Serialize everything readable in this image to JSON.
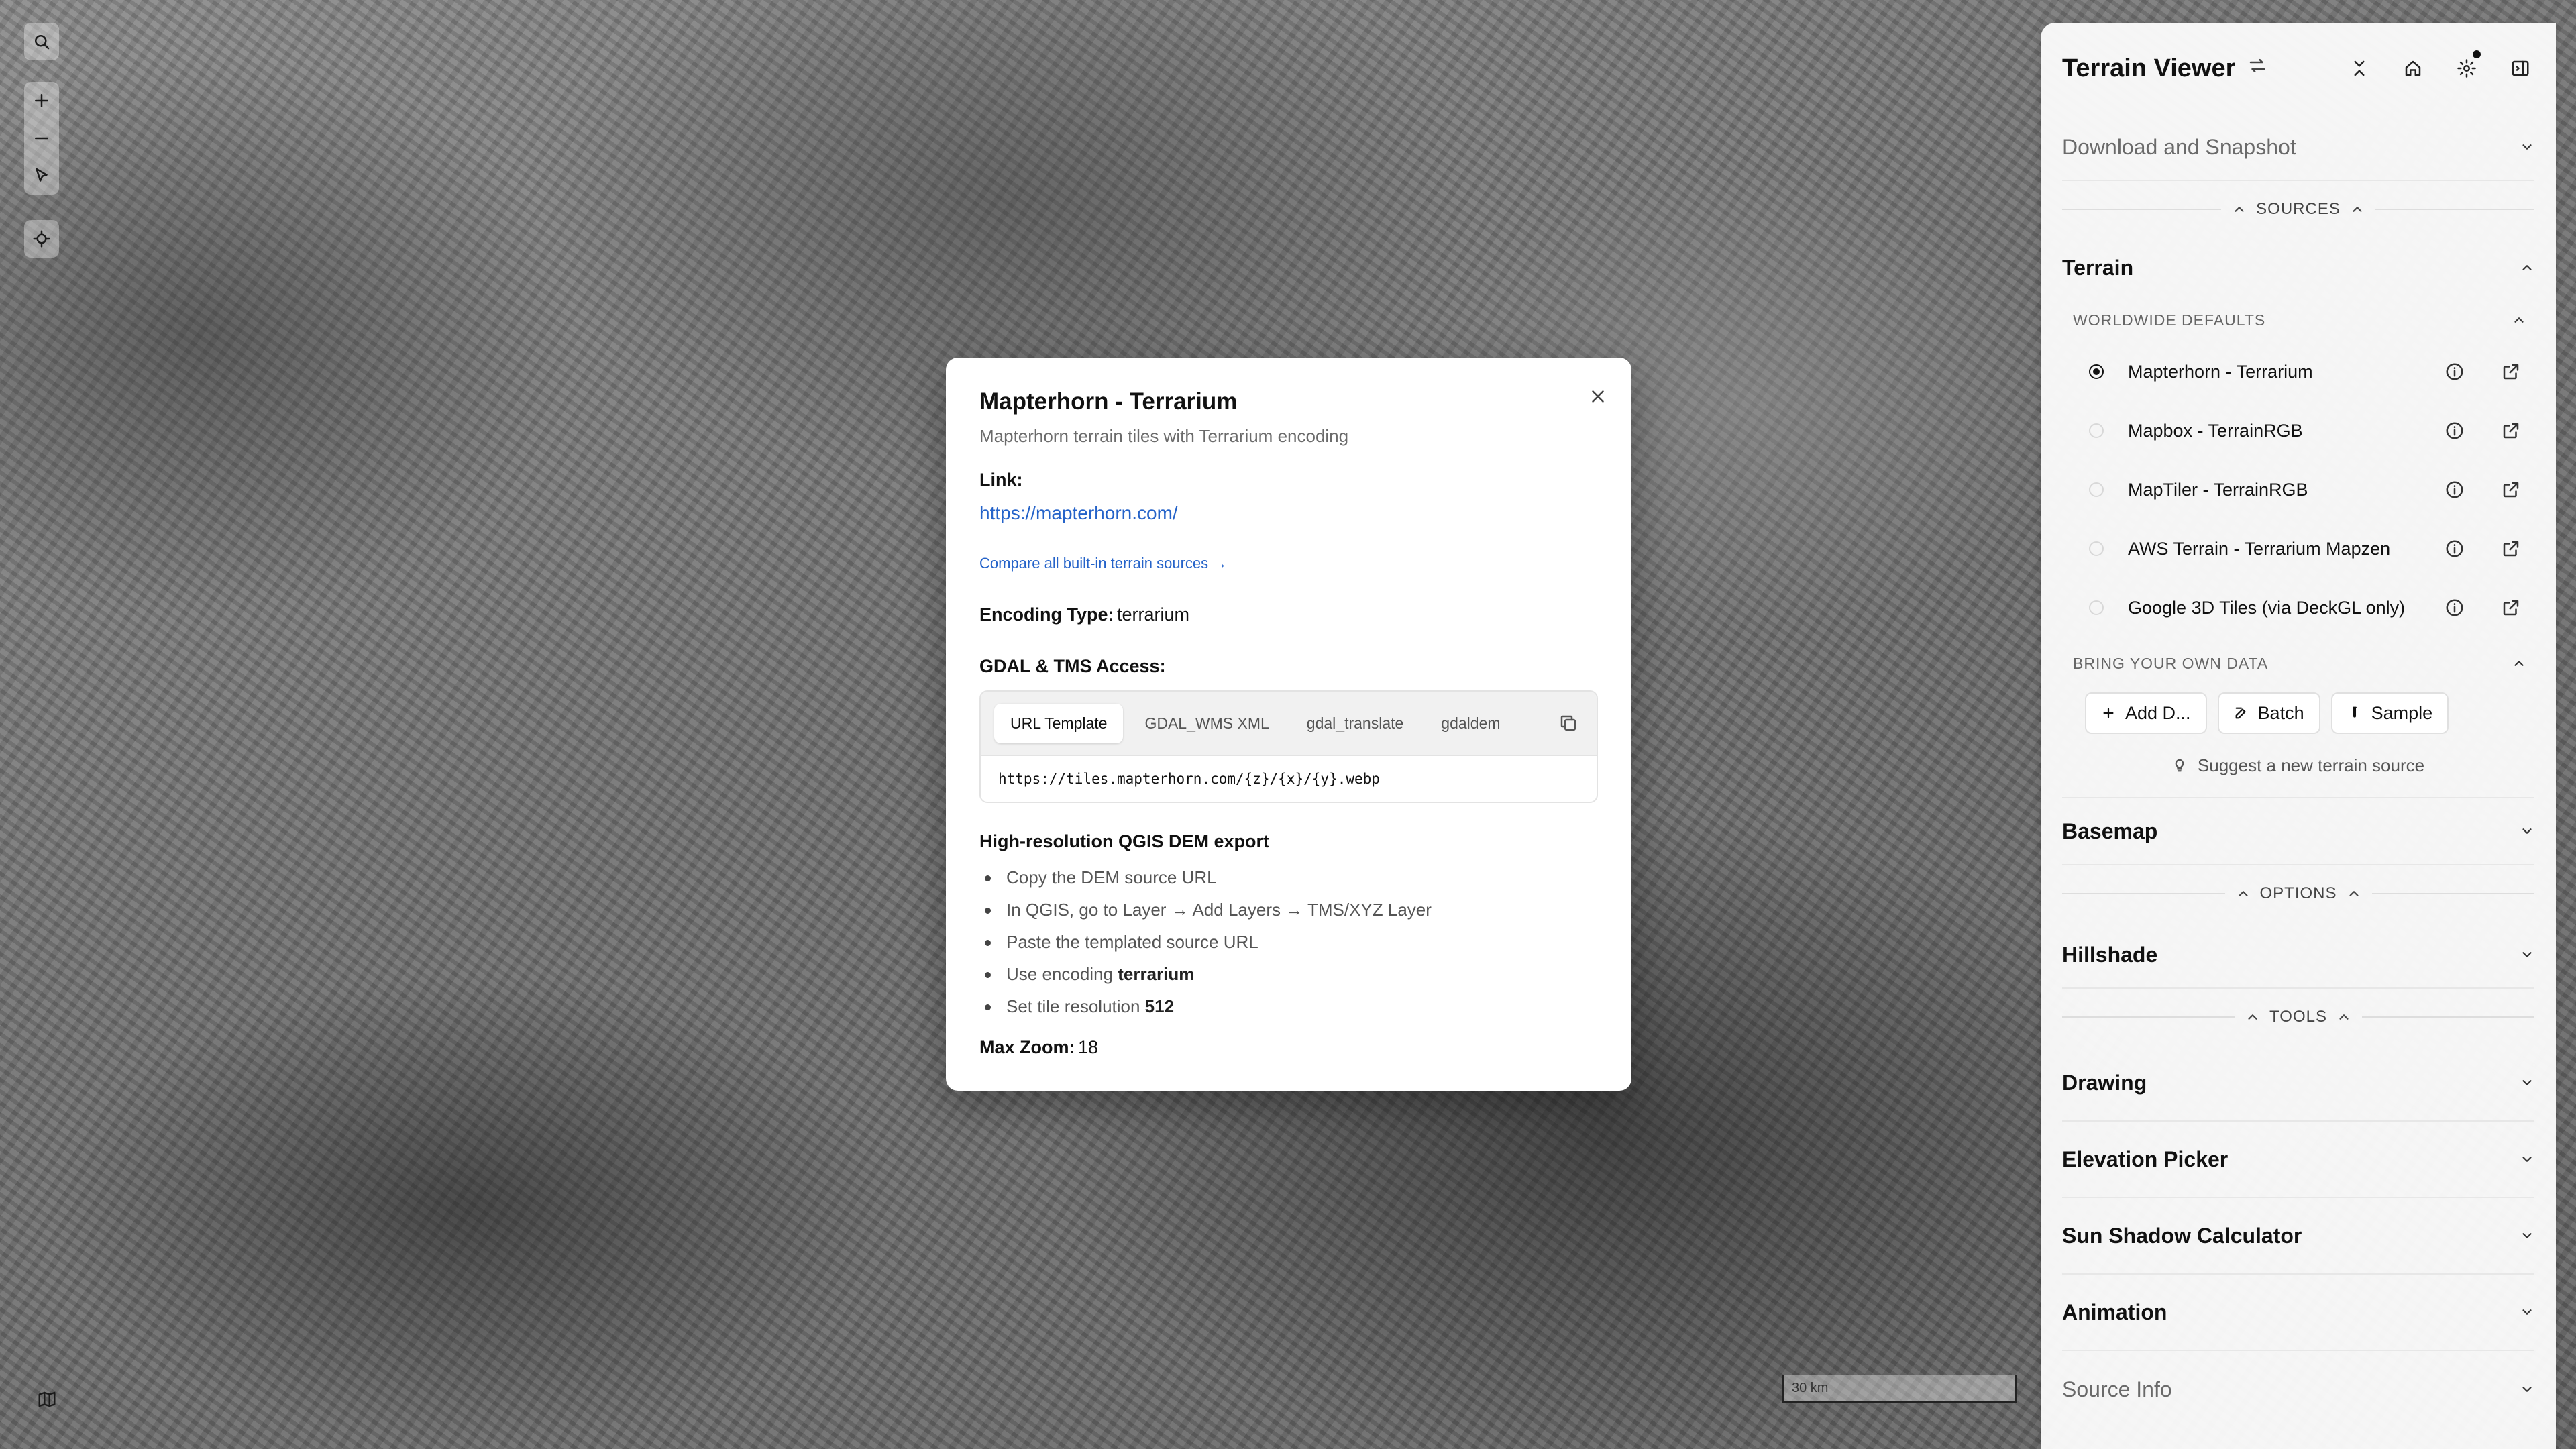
{
  "app": {
    "title": "Terrain Viewer"
  },
  "map": {
    "scale_label": "30 km"
  },
  "modal": {
    "title": "Mapterhorn - Terrarium",
    "subtitle": "Mapterhorn terrain tiles with Terrarium encoding",
    "link_label": "Link:",
    "link_url": "https://mapterhorn.com/",
    "compare_link": "Compare all built-in terrain sources →",
    "encoding_label": "Encoding Type:",
    "encoding_value": "terrarium",
    "gdal_label": "GDAL & TMS Access:",
    "tabs": [
      "URL Template",
      "GDAL_WMS XML",
      "gdal_translate",
      "gdaldem"
    ],
    "code": "https://tiles.mapterhorn.com/{z}/{x}/{y}.webp",
    "qgis_title": "High-resolution QGIS DEM export",
    "steps": {
      "s1": "Copy the DEM source URL",
      "s2": "In QGIS, go to Layer → Add Layers → TMS/XYZ Layer",
      "s3": "Paste the templated source URL",
      "s4_prefix": "Use encoding ",
      "s4_bold": "terrarium",
      "s5_prefix": "Set tile resolution ",
      "s5_bold": "512"
    },
    "maxzoom_label": "Max Zoom:",
    "maxzoom_value": "18"
  },
  "panel": {
    "download_section": "Download and Snapshot",
    "sources_label": "SOURCES",
    "terrain_section": "Terrain",
    "worldwide_label": "WORLDWIDE DEFAULTS",
    "sources": [
      {
        "name": "Mapterhorn - Terrarium",
        "selected": true
      },
      {
        "name": "Mapbox - TerrainRGB",
        "selected": false
      },
      {
        "name": "MapTiler - TerrainRGB",
        "selected": false
      },
      {
        "name": "AWS Terrain - Terrarium Mapzen",
        "selected": false
      },
      {
        "name": "Google 3D Tiles (via DeckGL only)",
        "selected": false
      }
    ],
    "own_data_label": "BRING YOUR OWN DATA",
    "own_buttons": {
      "add": "Add D...",
      "batch": "Batch",
      "sample": "Sample"
    },
    "suggest": "Suggest a new terrain source",
    "basemap_section": "Basemap",
    "options_label": "OPTIONS",
    "hillshade_section": "Hillshade",
    "tools_label": "TOOLS",
    "drawing_section": "Drawing",
    "elevation_section": "Elevation Picker",
    "sunshadow_section": "Sun Shadow Calculator",
    "animation_section": "Animation",
    "sourceinfo_section": "Source Info"
  }
}
